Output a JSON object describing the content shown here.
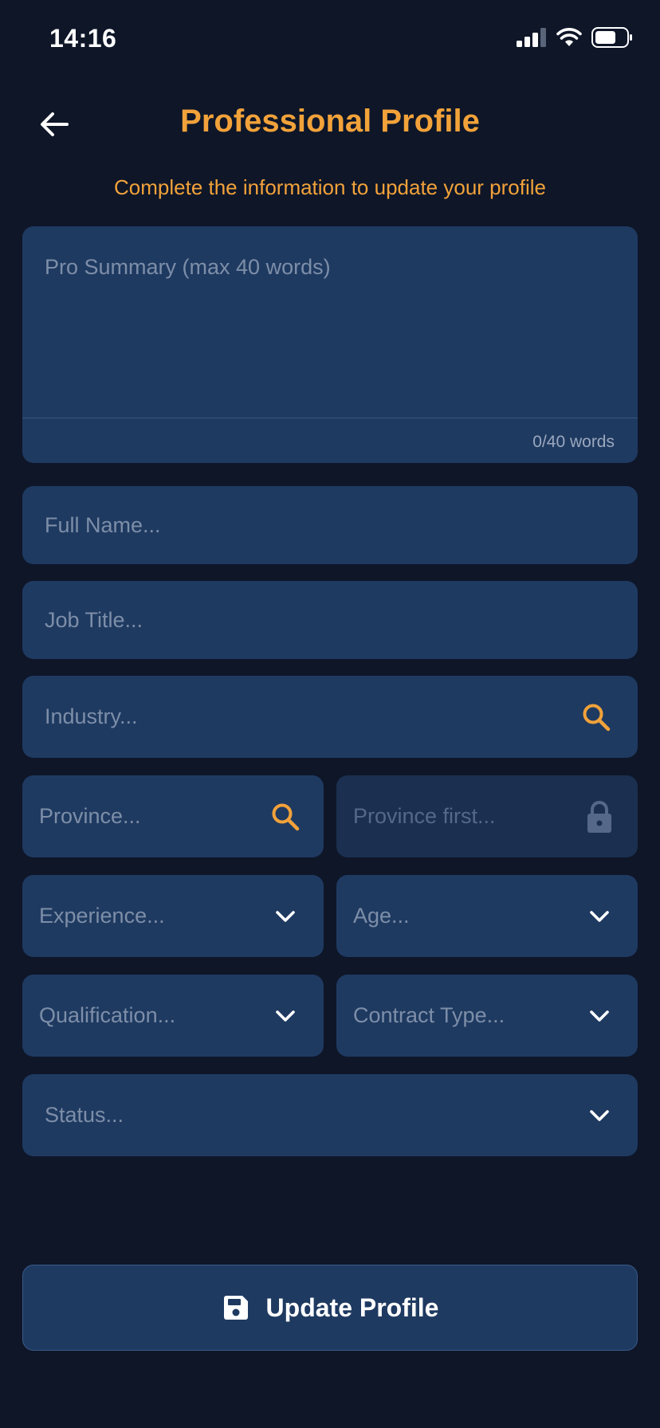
{
  "status_bar": {
    "time": "14:16"
  },
  "header": {
    "title": "Professional Profile",
    "subtitle": "Complete the information to update your profile"
  },
  "form": {
    "summary": {
      "placeholder": "Pro Summary (max 40 words)",
      "word_count": "0/40 words"
    },
    "full_name": {
      "placeholder": "Full Name..."
    },
    "job_title": {
      "placeholder": "Job Title..."
    },
    "industry": {
      "placeholder": "Industry..."
    },
    "province": {
      "placeholder": "Province..."
    },
    "city": {
      "placeholder": "Province first..."
    },
    "experience": {
      "placeholder": "Experience..."
    },
    "age": {
      "placeholder": "Age..."
    },
    "qualification": {
      "placeholder": "Qualification..."
    },
    "contract_type": {
      "placeholder": "Contract Type..."
    },
    "status": {
      "placeholder": "Status..."
    }
  },
  "actions": {
    "update_label": "Update Profile"
  },
  "colors": {
    "accent": "#f2a23a",
    "background": "#0e1628",
    "field": "#1f3a61"
  },
  "icons": [
    "back-arrow-icon",
    "search-icon",
    "lock-icon",
    "chevron-down-icon",
    "save-icon"
  ]
}
